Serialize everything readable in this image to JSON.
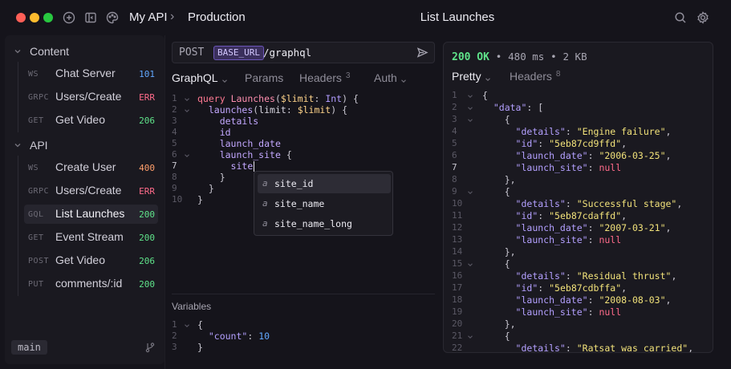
{
  "app": {
    "workspace": "My API",
    "breadcrumb_separator": "›",
    "environment": "Production",
    "request_title": "List Launches"
  },
  "colors": {
    "status_ok": "#5fe38a",
    "status_err": "#ff6b8a",
    "status_warn": "#ff9f6b",
    "status_info": "#62a8ff",
    "accent": "#6b55b8"
  },
  "sidebar": {
    "folders": [
      {
        "label": "Content",
        "items": [
          {
            "method": "WS",
            "name": "Chat Server",
            "status": "101",
            "status_kind": "info"
          },
          {
            "method": "GRPC",
            "name": "Users/Create",
            "status": "ERR",
            "status_kind": "err"
          },
          {
            "method": "GET",
            "name": "Get Video",
            "status": "206",
            "status_kind": "ok"
          }
        ]
      },
      {
        "label": "API",
        "items": [
          {
            "method": "WS",
            "name": "Create User",
            "status": "400",
            "status_kind": "warn"
          },
          {
            "method": "GRPC",
            "name": "Users/Create",
            "status": "ERR",
            "status_kind": "err"
          },
          {
            "method": "GQL",
            "name": "List Launches",
            "status": "200",
            "status_kind": "ok",
            "active": true
          },
          {
            "method": "GET",
            "name": "Event Stream",
            "status": "200",
            "status_kind": "ok"
          },
          {
            "method": "POST",
            "name": "Get Video",
            "status": "206",
            "status_kind": "ok"
          },
          {
            "method": "PUT",
            "name": "comments/:id",
            "status": "200",
            "status_kind": "ok"
          }
        ]
      }
    ],
    "branch": "main"
  },
  "request": {
    "method": "POST",
    "base_var": "BASE_URL",
    "path": "/graphql",
    "tabs": [
      {
        "label": "GraphQL",
        "active": true,
        "caret": true
      },
      {
        "label": "Params"
      },
      {
        "label": "Headers",
        "count": "3"
      },
      {
        "label": "Auth",
        "caret": true
      }
    ],
    "line_numbers": [
      "1",
      "2",
      "3",
      "4",
      "5",
      "6",
      "7",
      "8",
      "9",
      "10"
    ],
    "autocomplete": [
      {
        "icon": "a",
        "label": "site_id",
        "selected": true
      },
      {
        "icon": "a",
        "label": "site_name"
      },
      {
        "icon": "a",
        "label": "site_name_long"
      }
    ],
    "variables_label": "Variables",
    "variables_line_numbers": [
      "1",
      "2",
      "3"
    ]
  },
  "response": {
    "status": "200 OK",
    "time": "480 ms",
    "size": "2 KB",
    "separator": "•",
    "tabs": [
      {
        "label": "Pretty",
        "active": true,
        "caret": true
      },
      {
        "label": "Headers",
        "count": "8"
      }
    ],
    "data_key": "data",
    "records": [
      {
        "details": "Engine failure",
        "id": "5eb87cd9ffd",
        "launch_date": "2006-03-25",
        "launch_site": "null"
      },
      {
        "details": "Successful stage",
        "id": "5eb87cdaffd",
        "launch_date": "2007-03-21",
        "launch_site": "null"
      },
      {
        "details": "Residual thrust",
        "id": "5eb87cdbffa",
        "launch_date": "2008-08-03",
        "launch_site": "null"
      },
      {
        "details": "Ratsat was carried"
      }
    ],
    "line_numbers": [
      "1",
      "2",
      "3",
      "4",
      "5",
      "6",
      "7",
      "8",
      "9",
      "10",
      "11",
      "12",
      "13",
      "14",
      "15",
      "16",
      "17",
      "18",
      "19",
      "20",
      "21",
      "22"
    ]
  }
}
